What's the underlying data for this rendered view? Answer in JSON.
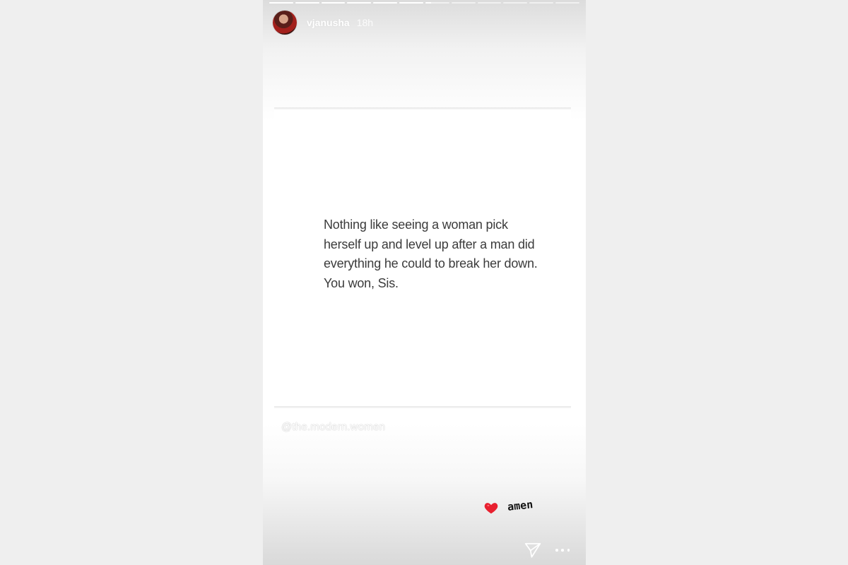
{
  "story": {
    "progress": [
      1,
      1,
      1,
      1,
      1,
      1,
      0.25,
      0,
      0,
      0,
      0,
      0
    ],
    "user": {
      "username": "vjanusha",
      "time_ago": "18h"
    },
    "quote": {
      "lines": [
        "Nothing like seeing a woman pick",
        "herself up and level up after a man did",
        "everything he could to break her down.",
        "You won, Sis."
      ]
    },
    "credit": "@the.modern.women",
    "sticker": {
      "icon": "heart-icon",
      "text": "amen",
      "heart_color": "#e8202f"
    },
    "actions": {
      "send_icon": "send-icon",
      "more_icon": "more-icon"
    }
  }
}
